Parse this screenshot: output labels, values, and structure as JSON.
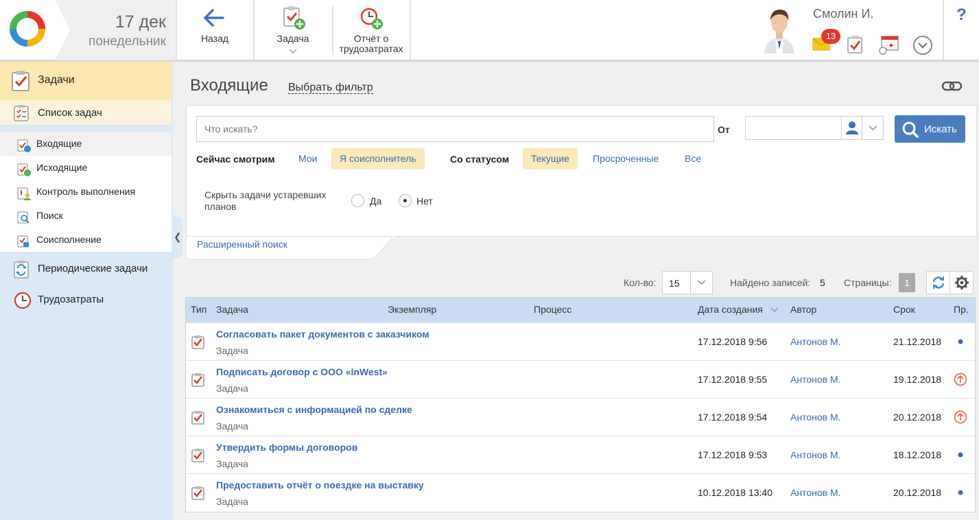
{
  "header": {
    "date_day": "17 дек",
    "date_weekday": "понедельник",
    "back_label": "Назад",
    "task_label": "Задача",
    "report_label_line1": "Отчёт о",
    "report_label_line2": "трудозатратах",
    "user_name": "Смолин И.",
    "notifications_count": "13",
    "help_label": "?"
  },
  "sidebar": {
    "section_title": "Задачи",
    "group_title": "Список задач",
    "items": [
      {
        "label": "Входящие",
        "icon": "incoming-icon"
      },
      {
        "label": "Исходящие",
        "icon": "outgoing-icon"
      },
      {
        "label": "Контроль выполнения",
        "icon": "control-icon"
      },
      {
        "label": "Поиск",
        "icon": "search-task-icon"
      },
      {
        "label": "Соисполнение",
        "icon": "coexecution-icon"
      }
    ],
    "periodic_label": "Периодические задачи",
    "labor_label": "Трудозатраты"
  },
  "main": {
    "title": "Входящие",
    "filter_link": "Выбрать фильтр"
  },
  "filter": {
    "search_placeholder": "Что искать?",
    "from_label": "От",
    "search_button": "Искать",
    "viewing_label": "Сейчас смотрим",
    "viewing_options": [
      "Мои",
      "Я соисполнитель"
    ],
    "viewing_selected": "Я соисполнитель",
    "status_label": "Со статусом",
    "status_options": [
      "Текущие",
      "Просроченные",
      "Все"
    ],
    "status_selected": "Текущие",
    "hide_label": "Скрыть задачи устаревших планов",
    "hide_yes": "Да",
    "hide_no": "Нет",
    "hide_selected": "Нет",
    "advanced_link": "Расширенный поиск"
  },
  "list_toolbar": {
    "qty_label": "Кол-во:",
    "qty_value": "15",
    "found_label": "Найдено записей:",
    "found_value": "5",
    "pages_label": "Страницы:",
    "page_current": "1"
  },
  "table": {
    "columns": [
      "Тип",
      "Задача",
      "Экземпляр",
      "Процесс",
      "Дата создания",
      "Автор",
      "Срок",
      "Пр."
    ],
    "rows": [
      {
        "title": "Согласовать пакет документов с заказчиком",
        "type": "Задача",
        "created": "17.12.2018 9:56",
        "author": "Антонов М.",
        "due": "21.12.2018",
        "priority": "normal"
      },
      {
        "title": "Подписать договор с ООО «InWest»",
        "type": "Задача",
        "created": "17.12.2018 9:55",
        "author": "Антонов М.",
        "due": "19.12.2018",
        "priority": "high"
      },
      {
        "title": "Ознакомиться с информацией по сделке",
        "type": "Задача",
        "created": "17.12.2018 9:54",
        "author": "Антонов М.",
        "due": "20.12.2018",
        "priority": "high"
      },
      {
        "title": "Утвердить формы договоров",
        "type": "Задача",
        "created": "17.12.2018 9:53",
        "author": "Антонов М.",
        "due": "18.12.2018",
        "priority": "normal"
      },
      {
        "title": "Предоставить отчёт о поездке на выставку",
        "type": "Задача",
        "created": "10.12.2018 13:40",
        "author": "Антонов М.",
        "due": "20.12.2018",
        "priority": "normal"
      }
    ]
  },
  "colors": {
    "accent": "#3a6ab5",
    "search_button": "#4a7dbf",
    "selected_chip": "#fbeab8",
    "sidebar_bg": "#dbe8f6",
    "badge": "#e4382a",
    "priority_high": "#f07050",
    "priority_normal": "#3a6ab5"
  }
}
